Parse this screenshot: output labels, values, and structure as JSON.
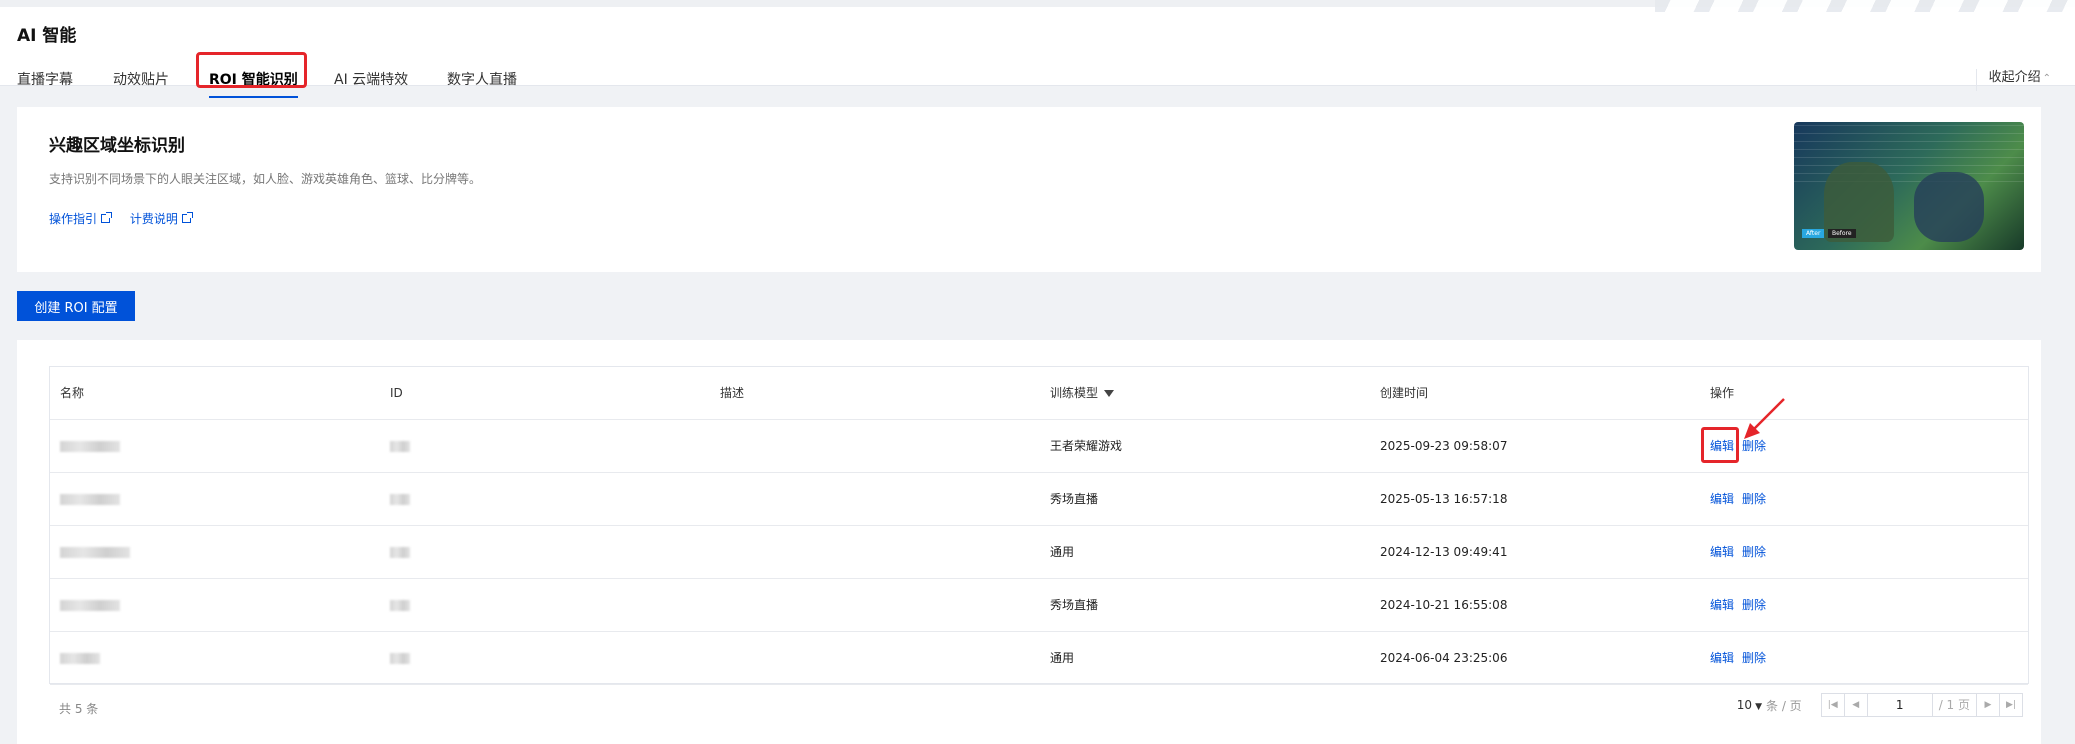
{
  "header": {
    "title": "AI 智能",
    "tabs": [
      {
        "label": "直播字幕"
      },
      {
        "label": "动效贴片"
      },
      {
        "label": "ROI 智能识别"
      },
      {
        "label": "AI 云端特效"
      },
      {
        "label": "数字人直播"
      }
    ],
    "collapse_label": "收起介绍"
  },
  "intro": {
    "title": "兴趣区域坐标识别",
    "description": "支持识别不同场景下的人眼关注区域，如人脸、游戏英雄角色、篮球、比分牌等。",
    "links": [
      {
        "label": "操作指引"
      },
      {
        "label": "计费说明"
      }
    ],
    "thumbnail": {
      "badge_after": "After",
      "badge_before": "Before"
    }
  },
  "create_button_label": "创建 ROI 配置",
  "table": {
    "columns": [
      "名称",
      "ID",
      "描述",
      "训练模型",
      "创建时间",
      "操作"
    ],
    "rows": [
      {
        "model": "王者荣耀游戏",
        "created": "2025-09-23 09:58:07"
      },
      {
        "model": "秀场直播",
        "created": "2025-05-13 16:57:18"
      },
      {
        "model": "通用",
        "created": "2024-12-13 09:49:41"
      },
      {
        "model": "秀场直播",
        "created": "2024-10-21 16:55:08"
      },
      {
        "model": "通用",
        "created": "2024-06-04 23:25:06"
      }
    ],
    "actions": {
      "edit": "编辑",
      "delete": "删除"
    }
  },
  "pagination": {
    "total": "共 5 条",
    "page_size": "10",
    "per_page_label": "条 / 页",
    "current_page": "1",
    "total_pages": "/ 1 页"
  },
  "colors": {
    "primary": "#0052d9",
    "highlight": "#e5252a",
    "background": "#f0f2f5"
  }
}
